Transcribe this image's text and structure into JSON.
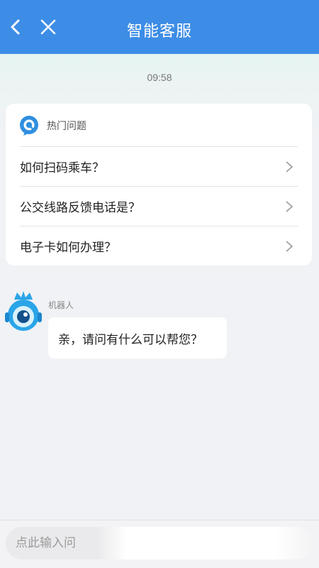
{
  "header": {
    "title": "智能客服",
    "back_icon": "chevron-left-icon",
    "close_icon": "close-icon",
    "background": "#3d8de6"
  },
  "chat": {
    "timestamp": "09:58",
    "faq": {
      "header_label": "热门问题",
      "icon": "q-bubble-icon",
      "accent": "#2f8fe0",
      "items": [
        {
          "label": "如何扫码乘车？"
        },
        {
          "label": "公交线路反馈电话是？"
        },
        {
          "label": "电子卡如何办理？"
        }
      ]
    },
    "bot_message": {
      "sender": "机器人",
      "avatar_icon": "robot-avatar-icon",
      "text": "亲，请问有什么可以帮您？"
    }
  },
  "input": {
    "placeholder": "点此输入问"
  }
}
